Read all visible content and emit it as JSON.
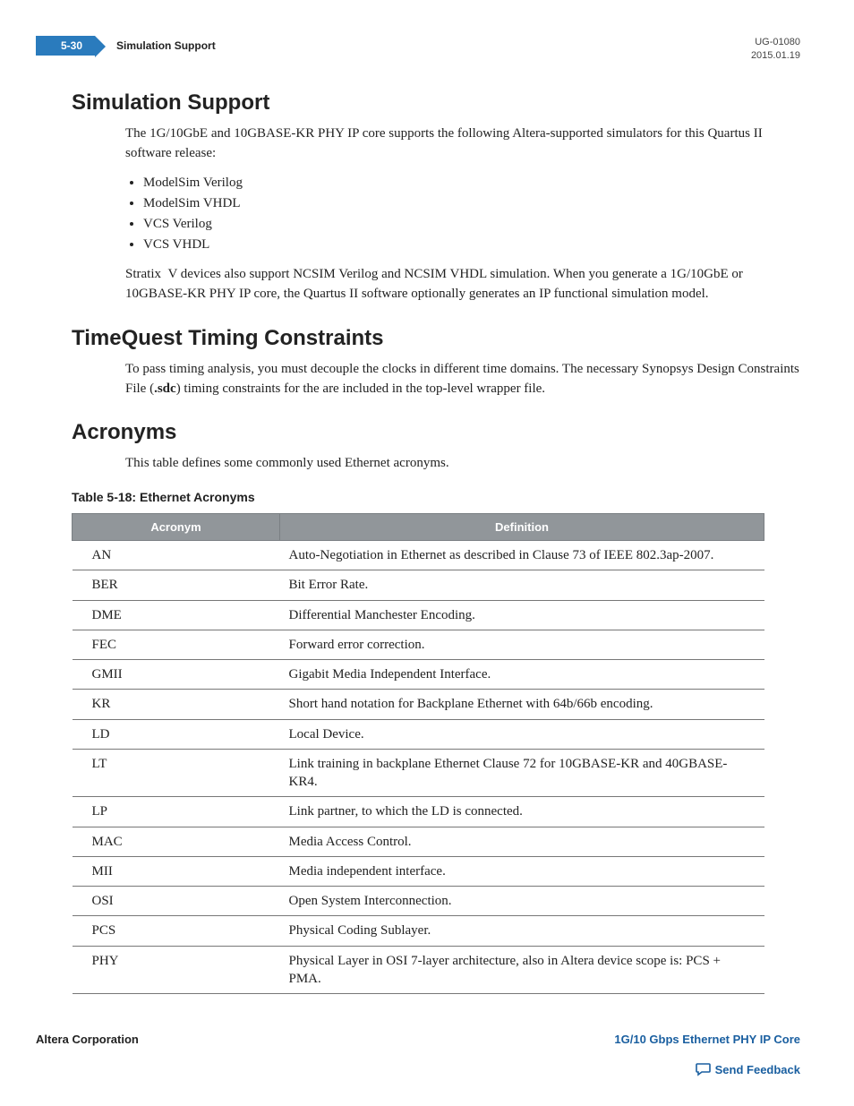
{
  "header": {
    "page_number": "5-30",
    "running_title": "Simulation Support",
    "doc_id": "UG-01080",
    "date": "2015.01.19"
  },
  "section1": {
    "heading": "Simulation Support",
    "intro": "The 1G/10GbE and 10GBASE-KR PHY IP core supports the following Altera-supported simulators for this Quartus II software release:",
    "bullets": [
      "ModelSim Verilog",
      "ModelSim VHDL",
      "VCS Verilog",
      "VCS VHDL"
    ],
    "para2": "Stratix  V devices also support NCSIM Verilog and NCSIM VHDL simulation. When you generate a 1G/10GbE or 10GBASE-KR PHY IP core, the Quartus II software optionally generates an IP functional simulation model."
  },
  "section2": {
    "heading": "TimeQuest Timing Constraints",
    "para_pre": "To pass timing analysis, you must decouple the clocks in different time domains. The necessary Synopsys Design Constraints File (",
    "bold": ".sdc",
    "para_post": ") timing constraints for the are included in the top-level wrapper file."
  },
  "section3": {
    "heading": "Acronyms",
    "intro": "This table defines some commonly used Ethernet acronyms.",
    "table_caption": "Table 5-18: Ethernet Acronyms",
    "th1": "Acronym",
    "th2": "Definition",
    "rows": [
      {
        "a": "AN",
        "d": "Auto-Negotiation in Ethernet as described in Clause 73 of IEEE 802.3ap-2007."
      },
      {
        "a": "BER",
        "d": "Bit Error Rate."
      },
      {
        "a": "DME",
        "d": "Differential Manchester Encoding."
      },
      {
        "a": "FEC",
        "d": "Forward error correction."
      },
      {
        "a": "GMII",
        "d": "Gigabit Media Independent Interface."
      },
      {
        "a": "KR",
        "d": "Short hand notation for Backplane Ethernet with 64b/66b encoding."
      },
      {
        "a": "LD",
        "d": "Local Device."
      },
      {
        "a": "LT",
        "d": "Link training in backplane Ethernet Clause 72 for 10GBASE-KR and 40GBASE-KR4."
      },
      {
        "a": "LP",
        "d": "Link partner, to which the LD is connected."
      },
      {
        "a": "MAC",
        "d": "Media Access Control."
      },
      {
        "a": "MII",
        "d": "Media independent interface."
      },
      {
        "a": "OSI",
        "d": "Open System Interconnection."
      },
      {
        "a": "PCS",
        "d": "Physical Coding Sublayer."
      },
      {
        "a": "PHY",
        "d": "Physical Layer in OSI 7-layer architecture, also in Altera device scope is: PCS + PMA."
      }
    ]
  },
  "footer": {
    "left": "Altera Corporation",
    "right": "1G/10 Gbps Ethernet PHY IP Core",
    "feedback": "Send Feedback"
  }
}
